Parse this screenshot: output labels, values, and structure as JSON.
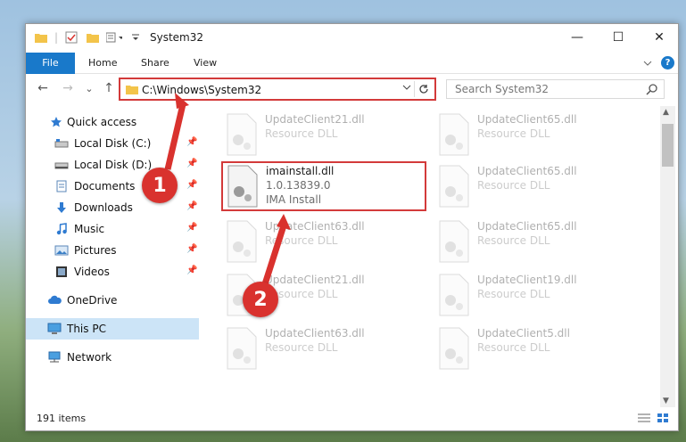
{
  "window": {
    "title": "System32",
    "caption_minimize": "—",
    "caption_maximize": "☐",
    "caption_close": "✕"
  },
  "ribbon": {
    "tabs": [
      "File",
      "Home",
      "Share",
      "View"
    ],
    "expand_icon": "chevron-down-icon",
    "help_label": "?"
  },
  "navigation": {
    "back": "←",
    "forward": "→",
    "recent": "⌄",
    "up": "↑",
    "address_path": "C:\\Windows\\System32",
    "search_placeholder": "Search System32"
  },
  "sidebar": {
    "items": [
      {
        "label": "Quick access",
        "icon": "star-icon",
        "pinned": false
      },
      {
        "label": "Local Disk (C:)",
        "icon": "drive-icon",
        "pinned": true
      },
      {
        "label": "Local Disk (D:)",
        "icon": "drive-icon",
        "pinned": true
      },
      {
        "label": "Documents",
        "icon": "document-icon",
        "pinned": true
      },
      {
        "label": "Downloads",
        "icon": "download-icon",
        "pinned": true
      },
      {
        "label": "Music",
        "icon": "music-icon",
        "pinned": true
      },
      {
        "label": "Pictures",
        "icon": "pictures-icon",
        "pinned": true
      },
      {
        "label": "Videos",
        "icon": "video-icon",
        "pinned": true
      },
      {
        "label": "OneDrive",
        "icon": "cloud-icon",
        "pinned": false
      },
      {
        "label": "This PC",
        "icon": "computer-icon",
        "pinned": false,
        "selected": true
      },
      {
        "label": "Network",
        "icon": "network-icon",
        "pinned": false
      }
    ]
  },
  "files": [
    {
      "name": "UpdateClient21.dll",
      "sub1": "Resource DLL",
      "sub2": "",
      "faded": true
    },
    {
      "name": "UpdateClient65.dll",
      "sub1": "Resource DLL",
      "sub2": "",
      "faded": true
    },
    {
      "name": "imainstall.dll",
      "sub1": "1.0.13839.0",
      "sub2": "IMA Install",
      "faded": false,
      "highlight": true
    },
    {
      "name": "UpdateClient65.dll",
      "sub1": "Resource DLL",
      "sub2": "",
      "faded": true
    },
    {
      "name": "UpdateClient63.dll",
      "sub1": "Resource DLL",
      "sub2": "",
      "faded": true
    },
    {
      "name": "UpdateClient65.dll",
      "sub1": "Resource DLL",
      "sub2": "",
      "faded": true
    },
    {
      "name": "UpdateClient21.dll",
      "sub1": "Resource DLL",
      "sub2": "",
      "faded": true
    },
    {
      "name": "UpdateClient19.dll",
      "sub1": "Resource DLL",
      "sub2": "",
      "faded": true
    },
    {
      "name": "UpdateClient63.dll",
      "sub1": "Resource DLL",
      "sub2": "",
      "faded": true
    },
    {
      "name": "UpdateClient5.dll",
      "sub1": "Resource DLL",
      "sub2": "",
      "faded": true
    }
  ],
  "status": {
    "item_count": "191 items"
  },
  "callouts": [
    "1",
    "2"
  ],
  "colors": {
    "accent": "#1979ca",
    "highlight_red": "#d33a3a",
    "selected_bg": "#cce4f7"
  }
}
